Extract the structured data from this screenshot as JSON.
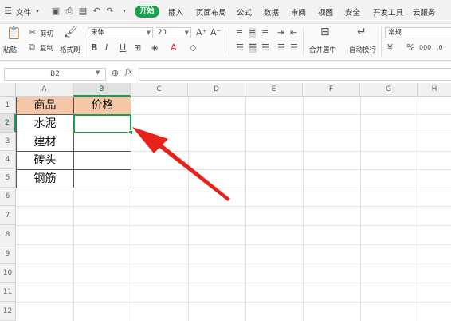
{
  "menubar": {
    "file": "文件",
    "tabs": [
      "开始",
      "插入",
      "页面布局",
      "公式",
      "数据",
      "审阅",
      "视图",
      "安全",
      "开发工具",
      "云服务"
    ]
  },
  "ribbon": {
    "paste": "粘贴",
    "cut": "剪切",
    "copy": "复制",
    "format_painter": "格式刷",
    "font_name": "宋体",
    "font_size": "20",
    "merge_center": "合并居中",
    "wrap_text": "自动换行",
    "number_format": "常规"
  },
  "formula_bar": {
    "name_box": "B2",
    "fx": "fx"
  },
  "sheet": {
    "columns": [
      "A",
      "B",
      "C",
      "D",
      "E",
      "F",
      "G",
      "H"
    ],
    "rows": [
      "1",
      "2",
      "3",
      "4",
      "5",
      "6",
      "7",
      "8",
      "9",
      "10",
      "11",
      "12"
    ],
    "selected_cell": "B2",
    "table": {
      "headers": [
        "商品",
        "价格"
      ],
      "items": [
        "水泥",
        "建材",
        "砖头",
        "钢筋"
      ]
    }
  },
  "colors": {
    "accent": "#1aa04c",
    "header_fill": "#f6c7a7",
    "arrow": "#e8221b"
  }
}
